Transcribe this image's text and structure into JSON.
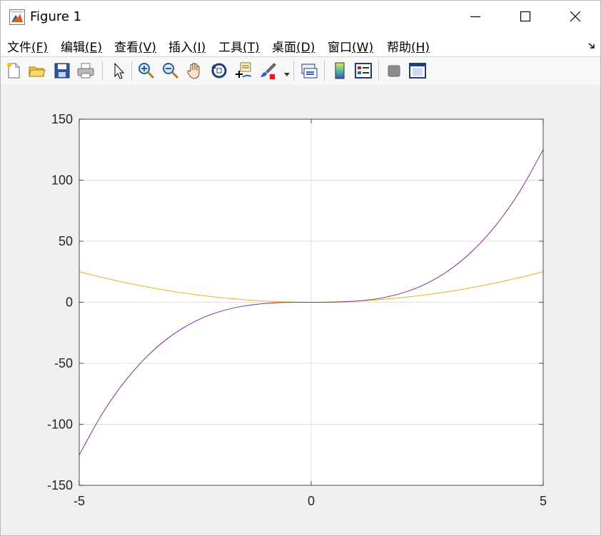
{
  "window": {
    "title": "Figure 1",
    "icon": "matlab-figure-icon"
  },
  "menu": [
    {
      "label": "文件",
      "key": "(F)"
    },
    {
      "label": "编辑",
      "key": "(E)"
    },
    {
      "label": "查看",
      "key": "(V)"
    },
    {
      "label": "插入",
      "key": "(I)"
    },
    {
      "label": "工具",
      "key": "(T)"
    },
    {
      "label": "桌面",
      "key": "(D)"
    },
    {
      "label": "窗口",
      "key": "(W)"
    },
    {
      "label": "帮助",
      "key": "(H)"
    }
  ],
  "toolbar": {
    "icons": [
      "new-figure-icon",
      "open-file-icon",
      "save-icon",
      "print-icon",
      "pointer-icon",
      "zoom-in-icon",
      "zoom-out-icon",
      "pan-hand-icon",
      "rotate-3d-icon",
      "data-cursor-icon",
      "brush-icon",
      "link-plot-icon",
      "colorbar-icon",
      "legend-icon",
      "hide-plot-tools-icon",
      "show-plot-tools-icon"
    ]
  },
  "colors": {
    "series_cubic": "#7e2f8e",
    "series_square": "#edb120",
    "grid": "#dfdfdf",
    "axes": "#262626"
  },
  "chart_data": {
    "type": "line",
    "title": "",
    "xlabel": "",
    "ylabel": "",
    "xlim": [
      -5,
      5
    ],
    "ylim": [
      -150,
      150
    ],
    "grid": true,
    "xticks": [
      -5,
      0,
      5
    ],
    "yticks": [
      150,
      100,
      50,
      0,
      -50,
      -100,
      -150
    ],
    "xtick_labels": [
      "-5",
      "0",
      "5"
    ],
    "ytick_labels": [
      "150",
      "100",
      "50",
      "0",
      "-50",
      "-100",
      "-150"
    ],
    "series": [
      {
        "color": "#7e2f8e",
        "x": [
          -5,
          -4.5,
          -4,
          -3.5,
          -3,
          -2.5,
          -2,
          -1.5,
          -1,
          -0.5,
          0,
          0.5,
          1,
          1.5,
          2,
          2.5,
          3,
          3.5,
          4,
          4.5,
          5
        ],
        "y": [
          -125,
          -91.1,
          -64,
          -42.9,
          -27,
          -15.6,
          -8,
          -3.4,
          -1,
          -0.1,
          0,
          0.1,
          1,
          3.4,
          8,
          15.6,
          27,
          42.9,
          64,
          91.1,
          125
        ]
      },
      {
        "color": "#edb120",
        "x": [
          -5,
          -4.5,
          -4,
          -3.5,
          -3,
          -2.5,
          -2,
          -1.5,
          -1,
          -0.5,
          0,
          0.5,
          1,
          1.5,
          2,
          2.5,
          3,
          3.5,
          4,
          4.5,
          5
        ],
        "y": [
          25,
          20.3,
          16,
          12.3,
          9,
          6.3,
          4,
          2.3,
          1,
          0.3,
          0,
          0.3,
          1,
          2.3,
          4,
          6.3,
          9,
          12.3,
          16,
          20.3,
          25
        ]
      }
    ]
  }
}
